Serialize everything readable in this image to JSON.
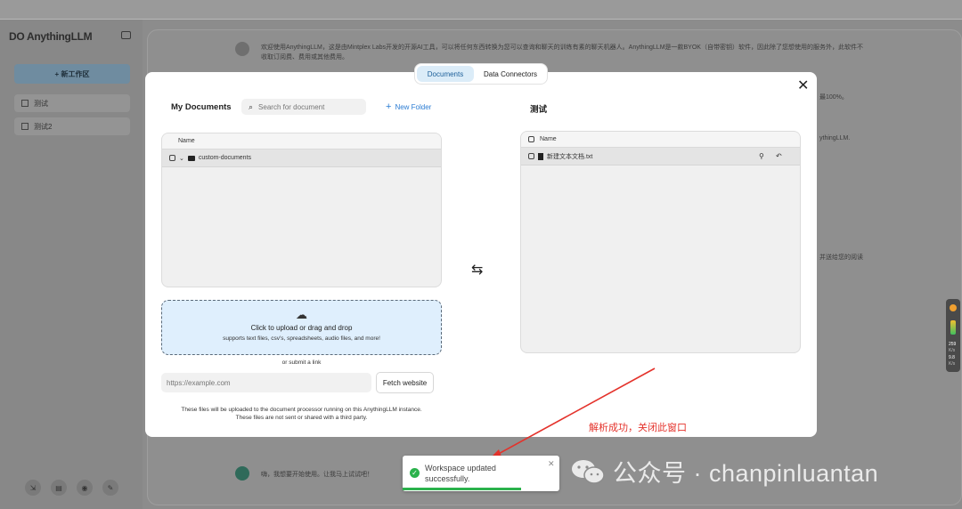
{
  "background_app": {
    "logo": "DO AnythingLLM",
    "new_workspace_label": "+ 新工作区",
    "workspaces": [
      "测试",
      "测试2"
    ],
    "chat_intro": "欢迎使用AnythingLLM，这是由Mintplex Labs开发的开源AI工具，可以将任何东西转换为您可以查询和聊天的训练有素的聊天机器人。AnythingLLM是一款BYOK（自带密钥）软件，因此除了您想使用的服务外，此软件不收取订阅费、费用或其他费用。",
    "chat_snippet_1": "最100%。",
    "chat_snippet_2": "ythingLLM.",
    "chat_snippet_3": "并送给您的阅读",
    "chat_prompt": "嗨，我想要开始使用。让我马上试试吧！"
  },
  "modal": {
    "tabs": [
      {
        "label": "Documents",
        "active": true
      },
      {
        "label": "Data Connectors",
        "active": false
      }
    ],
    "my_documents": {
      "title": "My Documents",
      "search_placeholder": "Search for document",
      "new_folder_label": "New Folder",
      "column_name": "Name",
      "folders": [
        {
          "name": "custom-documents"
        }
      ]
    },
    "upload": {
      "title": "Click to upload or drag and drop",
      "subtitle": "supports text files, csv's, spreadsheets, audio files, and more!",
      "or_submit_link": "or submit a link",
      "url_placeholder": "https://example.com",
      "fetch_button": "Fetch website",
      "notice_line1": "These files will be uploaded to the document processor running on this AnythingLLM instance.",
      "notice_line2": "These files are not sent or shared with a third party."
    },
    "workspace": {
      "title": "测试",
      "column_name": "Name",
      "files": [
        {
          "name": "新建文本文档.txt"
        }
      ]
    }
  },
  "toast": {
    "message": "Workspace updated successfully."
  },
  "annotation": "解析成功，关闭此窗口",
  "watermark": "公众号 · chanpinluantan",
  "side_widget": {
    "value1": "259",
    "unit1": "K/s",
    "value2": "9.8",
    "unit2": "K/s"
  },
  "colors": {
    "accent": "#2b7cd3",
    "success": "#2bb24c",
    "annotation": "#e4322b",
    "upload_bg": "#dfeffd"
  }
}
